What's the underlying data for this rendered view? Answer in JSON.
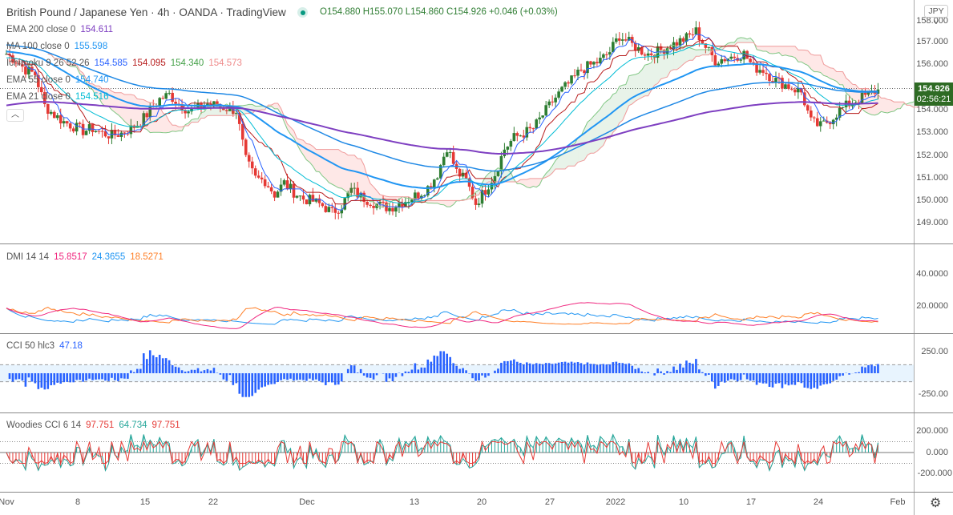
{
  "header": {
    "title": "British Pound / Japanese Yen · 4h · OANDA · TradingView",
    "open": "O154.880",
    "high": "H155.070",
    "low": "L154.860",
    "close": "C154.926",
    "change": "+0.046 (+0.03%)"
  },
  "legends": {
    "ema200": {
      "label": "EMA 200 close 0",
      "value": "154.611",
      "color": "#7e3fc1"
    },
    "ma100": {
      "label": "MA 100 close 0",
      "value": "155.598",
      "color": "#2196f3"
    },
    "ichimoku": {
      "label": "Ichimoku 9 26 52 26",
      "v1": "154.585",
      "v2": "154.095",
      "v3": "154.340",
      "v4": "154.573"
    },
    "ema55": {
      "label": "EMA 55 close 0",
      "value": "154.740"
    },
    "ema21": {
      "label": "EMA 21 close 0",
      "value": "154.516"
    },
    "dmi": {
      "label": "DMI 14 14",
      "v1": "15.8517",
      "v2": "24.3655",
      "v3": "18.5271"
    },
    "cci": {
      "label": "CCI 50 hlc3",
      "value": "47.18"
    },
    "woodies": {
      "label": "Woodies CCI 6 14",
      "v1": "97.751",
      "v2": "64.734",
      "v3": "97.751"
    }
  },
  "currency_button": "JPY ˅",
  "price_tag": {
    "price": "154.926",
    "countdown": "02:56:21"
  },
  "axes": {
    "price": [
      "157.000",
      "156.000",
      "154.000",
      "153.000",
      "152.000",
      "151.000",
      "150.000",
      "149.000"
    ],
    "price_top_partial": "158.000",
    "dmi": [
      "40.0000",
      "20.0000"
    ],
    "cci": [
      "250.00",
      "-250.00"
    ],
    "woodies": [
      "200.000",
      "0.000",
      "-200.000"
    ],
    "time": [
      "Nov",
      "8",
      "15",
      "22",
      "Dec",
      "13",
      "20",
      "27",
      "2022",
      "10",
      "17",
      "24",
      "Feb"
    ]
  },
  "colors": {
    "up": "#2e7d32",
    "down": "#e53935",
    "ma100": "#2196f3",
    "ema200": "#7e3fc1",
    "dmi_plus": "#2196f3",
    "dmi_minus": "#ff7f27",
    "adx": "#f0277f",
    "cci": "#2962ff",
    "woodies_fast": "#e53935",
    "woodies_slow": "#26a69a"
  },
  "chart_data": {
    "type": "candlestick",
    "x_start": "Nov 1",
    "interval": "daily approx",
    "ylim": [
      148.5,
      158
    ],
    "closes": [
      156.5,
      156.2,
      155.8,
      155.6,
      154.2,
      153.8,
      153.5,
      153.3,
      153.1,
      153.2,
      153.0,
      152.9,
      153.0,
      153.2,
      153.5,
      154.0,
      154.5,
      154.7,
      154.3,
      154.0,
      154.1,
      154.3,
      154.2,
      154.1,
      154.0,
      151.8,
      151.0,
      150.9,
      150.3,
      150.8,
      150.4,
      150.1,
      150.0,
      149.8,
      149.5,
      149.8,
      150.5,
      150.2,
      150.0,
      149.8,
      149.7,
      149.9,
      150.1,
      150.3,
      150.6,
      151.2,
      152.4,
      151.3,
      150.9,
      149.9,
      150.5,
      151.2,
      152.3,
      152.8,
      153.0,
      153.2,
      153.8,
      154.4,
      154.9,
      155.3,
      155.8,
      156.0,
      156.2,
      156.6,
      157.3,
      157.0,
      156.7,
      156.5,
      156.6,
      156.8,
      157.0,
      157.2,
      157.5,
      156.8,
      156.2,
      156.3,
      156.4,
      156.5,
      155.9,
      155.8,
      155.4,
      155.2,
      155.0,
      154.8,
      153.5,
      153.3,
      153.6,
      154.0,
      154.3,
      154.5,
      154.7,
      154.926
    ]
  }
}
